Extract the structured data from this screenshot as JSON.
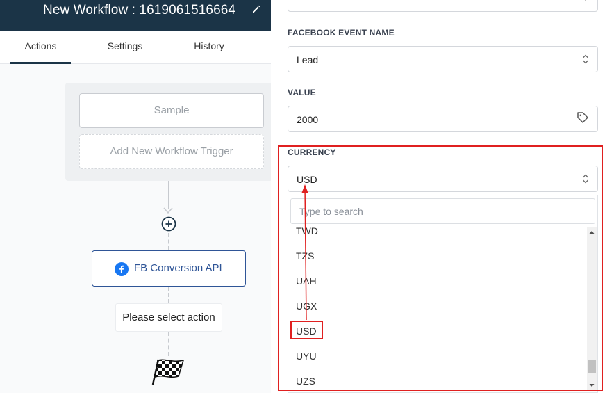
{
  "header": {
    "workflow_title": "New Workflow : 1619061516664",
    "edit_icon": "pencil-icon"
  },
  "tabs": [
    {
      "label": "Actions",
      "active": true
    },
    {
      "label": "Settings",
      "active": false
    },
    {
      "label": "History",
      "active": false
    }
  ],
  "canvas": {
    "trigger_sample": "Sample",
    "add_trigger": "Add New Workflow Trigger",
    "action_node_label": "FB Conversion API",
    "action_node_icon": "facebook-icon",
    "add_step_icon": "plus-circle-icon",
    "select_action": "Please select action",
    "end_icon": "finish-flag-icon"
  },
  "form": {
    "event_name_label": "FACEBOOK EVENT NAME",
    "event_name_value": "Lead",
    "value_label": "VALUE",
    "value_value": "2000",
    "value_icon": "tag-icon",
    "currency_label": "CURRENCY",
    "currency_value": "USD"
  },
  "dropdown": {
    "search_placeholder": "Type to search",
    "options": [
      "TWD",
      "TZS",
      "UAH",
      "UGX",
      "USD",
      "UYU",
      "UZS"
    ],
    "selected": "USD"
  },
  "colors": {
    "header_bg": "#1b3447",
    "accent_blue": "#2f5597",
    "annotation_red": "#e02020"
  }
}
